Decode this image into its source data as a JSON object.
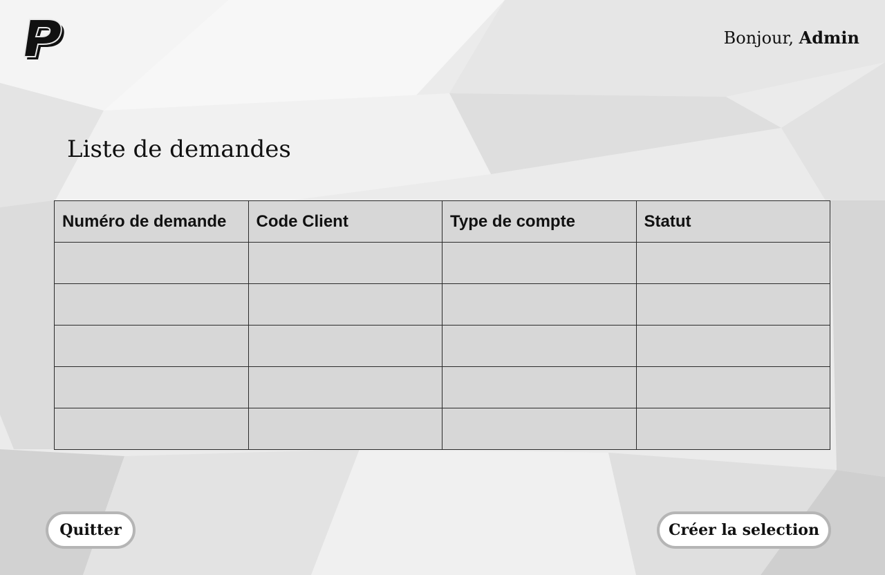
{
  "header": {
    "greeting_prefix": "Bonjour,",
    "user_name": "Admin"
  },
  "main": {
    "title": "Liste de demandes",
    "table": {
      "columns": [
        "Numéro de demande",
        "Code Client",
        "Type de compte",
        "Statut"
      ],
      "rows": [
        [
          "",
          "",
          "",
          ""
        ],
        [
          "",
          "",
          "",
          ""
        ],
        [
          "",
          "",
          "",
          ""
        ],
        [
          "",
          "",
          "",
          ""
        ],
        [
          "",
          "",
          "",
          ""
        ]
      ]
    }
  },
  "footer": {
    "quit_label": "Quitter",
    "create_label": "Créer la selection"
  },
  "colors": {
    "background": "#e9e9e9",
    "table_fill": "#d7d7d7",
    "button_fill": "#ffffff",
    "button_border": "#b5b5b5"
  },
  "icons": {
    "logo": "paypal-logo-icon"
  }
}
